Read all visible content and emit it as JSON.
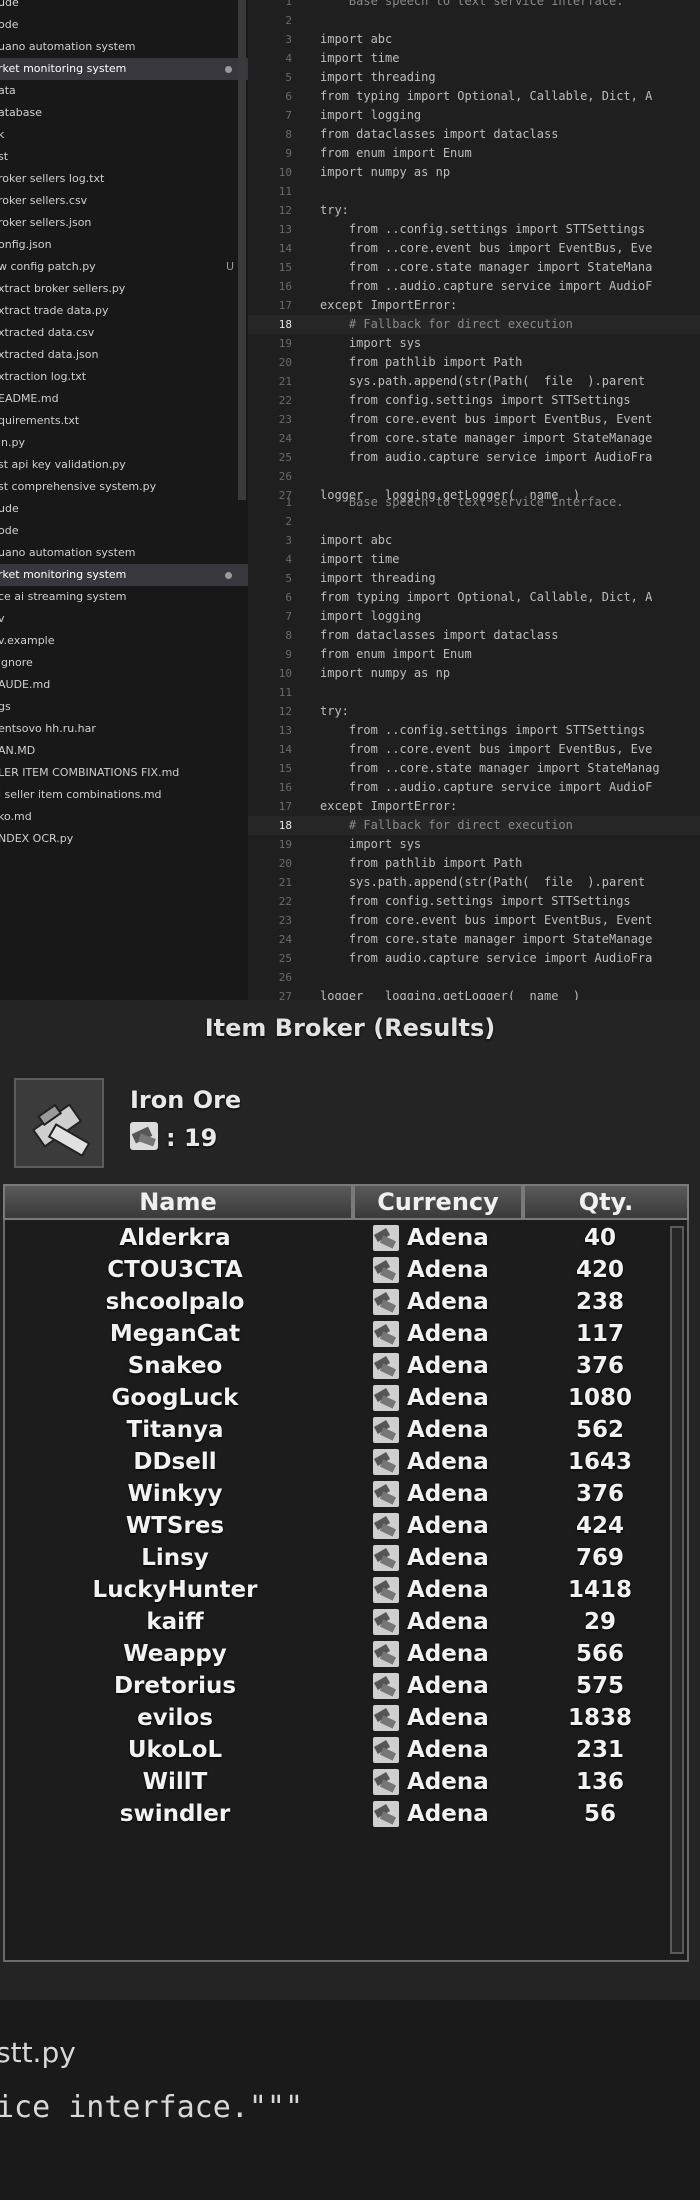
{
  "sidebar": {
    "files": [
      {
        "name": "ude",
        "state": ""
      },
      {
        "name": "ode",
        "state": ""
      },
      {
        "name": "uano automation system",
        "state": ""
      },
      {
        "name": "rket monitoring system",
        "state": "selected-dot"
      },
      {
        "name": "ata",
        "state": ""
      },
      {
        "name": "atabase",
        "state": ""
      },
      {
        "name": "k",
        "state": ""
      },
      {
        "name": "st",
        "state": ""
      },
      {
        "name": "roker sellers log.txt",
        "state": ""
      },
      {
        "name": "roker sellers.csv",
        "state": ""
      },
      {
        "name": "roker sellers.json",
        "state": ""
      },
      {
        "name": "onfig.json",
        "state": ""
      },
      {
        "name": "w config patch.py",
        "state": "U"
      },
      {
        "name": "xtract broker sellers.py",
        "state": ""
      },
      {
        "name": "xtract trade data.py",
        "state": ""
      },
      {
        "name": "xtracted data.csv",
        "state": ""
      },
      {
        "name": "xtracted data.json",
        "state": ""
      },
      {
        "name": "xtraction log.txt",
        "state": ""
      },
      {
        "name": "EADME.md",
        "state": ""
      },
      {
        "name": "quirements.txt",
        "state": ""
      },
      {
        "name": "in.py",
        "state": ""
      },
      {
        "name": "st api key validation.py",
        "state": ""
      },
      {
        "name": "st comprehensive system.py",
        "state": ""
      },
      {
        "name": "ude",
        "state": ""
      },
      {
        "name": "ode",
        "state": ""
      },
      {
        "name": "uano automation system",
        "state": ""
      },
      {
        "name": "rket monitoring system",
        "state": "selected-dot"
      },
      {
        "name": "ce ai streaming system",
        "state": ""
      },
      {
        "name": "v",
        "state": ""
      },
      {
        "name": "v.example",
        "state": ""
      },
      {
        "name": "ignore",
        "state": ""
      },
      {
        "name": "AUDE.md",
        "state": ""
      },
      {
        "name": "gs",
        "state": ""
      },
      {
        "name": "entsovo hh.ru.har",
        "state": ""
      },
      {
        "name": "AN.MD",
        "state": ""
      },
      {
        "name": "LER ITEM COMBINATIONS FIX.md",
        "state": ""
      },
      {
        "name": "l seller item combinations.md",
        "state": ""
      },
      {
        "name": "ko.md",
        "state": ""
      },
      {
        "name": "NDEX OCR.py",
        "state": ""
      }
    ]
  },
  "code": {
    "block1": [
      {
        "n": "1",
        "t": "    Base speech to text service interface.",
        "cls": "cm"
      },
      {
        "n": "2",
        "t": ""
      },
      {
        "n": "3",
        "t": "import abc"
      },
      {
        "n": "4",
        "t": "import time"
      },
      {
        "n": "5",
        "t": "import threading"
      },
      {
        "n": "6",
        "t": "from typing import Optional, Callable, Dict, A"
      },
      {
        "n": "7",
        "t": "import logging"
      },
      {
        "n": "8",
        "t": "from dataclasses import dataclass"
      },
      {
        "n": "9",
        "t": "from enum import Enum"
      },
      {
        "n": "10",
        "t": "import numpy as np"
      },
      {
        "n": "11",
        "t": ""
      },
      {
        "n": "12",
        "t": "try:"
      },
      {
        "n": "13",
        "t": "    from ..config.settings import STTSettings"
      },
      {
        "n": "14",
        "t": "    from ..core.event bus import EventBus, Eve"
      },
      {
        "n": "15",
        "t": "    from ..core.state manager import StateMana"
      },
      {
        "n": "16",
        "t": "    from ..audio.capture service import AudioF"
      },
      {
        "n": "17",
        "t": "except ImportError:"
      },
      {
        "n": "18",
        "t": "    # Fallback for direct execution",
        "cls": "cm",
        "cur": true
      },
      {
        "n": "19",
        "t": "    import sys"
      },
      {
        "n": "20",
        "t": "    from pathlib import Path"
      },
      {
        "n": "21",
        "t": "    sys.path.append(str(Path(  file  ).parent"
      },
      {
        "n": "22",
        "t": "    from config.settings import STTSettings"
      },
      {
        "n": "23",
        "t": "    from core.event bus import EventBus, Event"
      },
      {
        "n": "24",
        "t": "    from core.state manager import StateManage"
      },
      {
        "n": "25",
        "t": "    from audio.capture service import AudioFra"
      },
      {
        "n": "26",
        "t": ""
      },
      {
        "n": "27",
        "t": "logger   logging.getLogger(  name  )"
      }
    ],
    "block2": [
      {
        "n": "1",
        "t": "    Base speech to text service interface.",
        "cls": "cm"
      },
      {
        "n": "2",
        "t": ""
      },
      {
        "n": "3",
        "t": "import abc"
      },
      {
        "n": "4",
        "t": "import time"
      },
      {
        "n": "5",
        "t": "import threading"
      },
      {
        "n": "6",
        "t": "from typing import Optional, Callable, Dict, A"
      },
      {
        "n": "7",
        "t": "import logging"
      },
      {
        "n": "8",
        "t": "from dataclasses import dataclass"
      },
      {
        "n": "9",
        "t": "from enum import Enum"
      },
      {
        "n": "10",
        "t": "import numpy as np"
      },
      {
        "n": "11",
        "t": ""
      },
      {
        "n": "12",
        "t": "try:"
      },
      {
        "n": "13",
        "t": "    from ..config.settings import STTSettings"
      },
      {
        "n": "14",
        "t": "    from ..core.event bus import EventBus, Eve"
      },
      {
        "n": "15",
        "t": "    from ..core.state manager import StateManag"
      },
      {
        "n": "16",
        "t": "    from ..audio.capture service import AudioF"
      },
      {
        "n": "17",
        "t": "except ImportError:"
      },
      {
        "n": "18",
        "t": "    # Fallback for direct execution",
        "cls": "cm",
        "cur": true
      },
      {
        "n": "19",
        "t": "    import sys"
      },
      {
        "n": "20",
        "t": "    from pathlib import Path"
      },
      {
        "n": "21",
        "t": "    sys.path.append(str(Path(  file  ).parent"
      },
      {
        "n": "22",
        "t": "    from config.settings import STTSettings"
      },
      {
        "n": "23",
        "t": "    from core.event bus import EventBus, Event"
      },
      {
        "n": "24",
        "t": "    from core.state manager import StateManage"
      },
      {
        "n": "25",
        "t": "    from audio.capture service import AudioFra"
      },
      {
        "n": "26",
        "t": ""
      },
      {
        "n": "27",
        "t": "logger   logging.getLogger(  name  )"
      }
    ]
  },
  "broker": {
    "title": "Item Broker (Results)",
    "item_name": "Iron Ore",
    "item_count": ": 19",
    "columns": {
      "name": "Name",
      "currency": "Currency",
      "qty": "Qty."
    },
    "rows": [
      {
        "name": "Alderkra",
        "currency": "Adena",
        "qty": "40"
      },
      {
        "name": "CTOU3CTA",
        "currency": "Adena",
        "qty": "420"
      },
      {
        "name": "shcoolpalo",
        "currency": "Adena",
        "qty": "238"
      },
      {
        "name": "MeganCat",
        "currency": "Adena",
        "qty": "117"
      },
      {
        "name": "Snakeo",
        "currency": "Adena",
        "qty": "376"
      },
      {
        "name": "GoogLuck",
        "currency": "Adena",
        "qty": "1080"
      },
      {
        "name": "Titanya",
        "currency": "Adena",
        "qty": "562"
      },
      {
        "name": "DDsell",
        "currency": "Adena",
        "qty": "1643"
      },
      {
        "name": "Winkyy",
        "currency": "Adena",
        "qty": "376"
      },
      {
        "name": "WTSres",
        "currency": "Adena",
        "qty": "424"
      },
      {
        "name": "Linsy",
        "currency": "Adena",
        "qty": "769"
      },
      {
        "name": "LuckyHunter",
        "currency": "Adena",
        "qty": "1418"
      },
      {
        "name": "kaiff",
        "currency": "Adena",
        "qty": "29"
      },
      {
        "name": "Weappy",
        "currency": "Adena",
        "qty": "566"
      },
      {
        "name": "Dretorius",
        "currency": "Adena",
        "qty": "575"
      },
      {
        "name": "evilos",
        "currency": "Adena",
        "qty": "1838"
      },
      {
        "name": "UkoLoL",
        "currency": "Adena",
        "qty": "231"
      },
      {
        "name": "WillT",
        "currency": "Adena",
        "qty": "136"
      },
      {
        "name": "swindler",
        "currency": "Adena",
        "qty": "56"
      }
    ]
  },
  "bottom": {
    "filename": "stt.py",
    "code_line": "ice interface.\"\"\""
  }
}
